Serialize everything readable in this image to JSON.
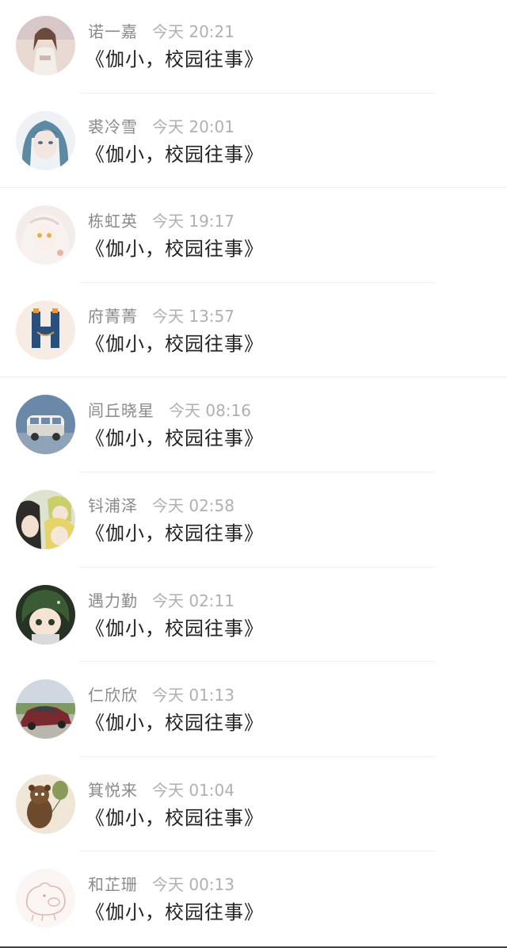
{
  "comments": [
    {
      "name": "诺一嘉",
      "time": "今天 20:21",
      "text": "《伽小，校园往事》",
      "avatar_icon": "girl-portrait-avatar"
    },
    {
      "name": "裘冷雪",
      "time": "今天 20:01",
      "text": "《伽小，校园往事》",
      "avatar_icon": "anime-blue-hair-avatar"
    },
    {
      "name": "栋虹英",
      "time": "今天 19:17",
      "text": "《伽小，校园往事》",
      "avatar_icon": "anime-white-hair-avatar"
    },
    {
      "name": "府菁菁",
      "time": "今天 13:57",
      "text": "《伽小，校园往事》",
      "avatar_icon": "letter-h-avatar"
    },
    {
      "name": "闾丘晓星",
      "time": "今天 08:16",
      "text": "《伽小，校园往事》",
      "avatar_icon": "vintage-van-avatar"
    },
    {
      "name": "钭浦泽",
      "time": "今天 02:58",
      "text": "《伽小，校园往事》",
      "avatar_icon": "anime-group-avatar"
    },
    {
      "name": "遇力勤",
      "time": "今天 02:11",
      "text": "《伽小，校园往事》",
      "avatar_icon": "chibi-green-hair-avatar"
    },
    {
      "name": "仁欣欣",
      "time": "今天 01:13",
      "text": "《伽小，校园往事》",
      "avatar_icon": "red-car-avatar"
    },
    {
      "name": "箕悦来",
      "time": "今天 01:04",
      "text": "《伽小，校园往事》",
      "avatar_icon": "bear-balloon-avatar"
    },
    {
      "name": "和芷珊",
      "time": "今天 00:13",
      "text": "《伽小，校园往事》",
      "avatar_icon": "pig-sketch-avatar"
    }
  ]
}
